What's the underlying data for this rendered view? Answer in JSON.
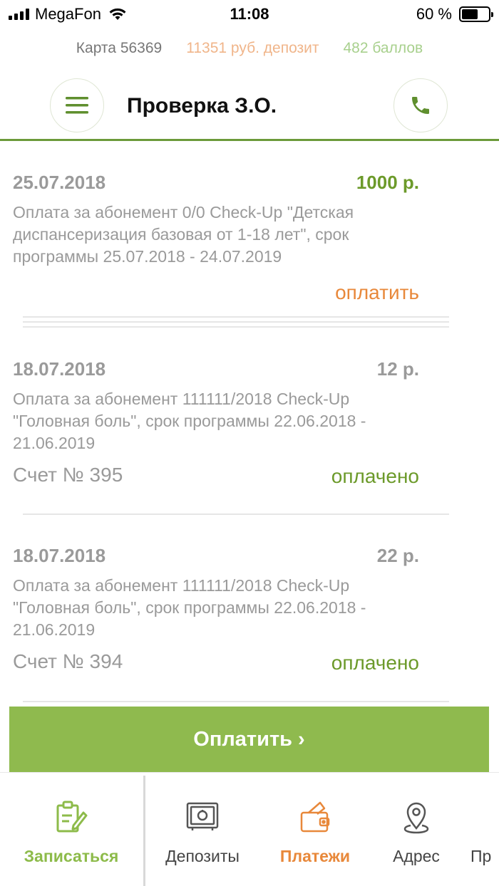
{
  "status_bar": {
    "carrier": "MegaFon",
    "time": "11:08",
    "battery": "60 %",
    "battery_level": 0.6
  },
  "info": {
    "card": "Карта 56369",
    "deposit": "11351 руб. депозит",
    "points": "482 баллов"
  },
  "header": {
    "title": "Проверка З.О.",
    "menu_icon": "menu-icon",
    "phone_icon": "phone-icon"
  },
  "payments": [
    {
      "date": "25.07.2018",
      "amount": "1000 р.",
      "description": "Оплата за абонемент 0/0 Check-Up \"Детская диспансеризация базовая от 1-18 лет\", срок программы 25.07.2018 - 24.07.2019",
      "action": "оплатить"
    },
    {
      "date": "18.07.2018",
      "amount": "12 р.",
      "description": "Оплата за абонемент 111111/2018 Check-Up \"Головная боль\", срок программы 22.06.2018 - 21.06.2019",
      "invoice": "Счет № 395",
      "status": "оплачено"
    },
    {
      "date": "18.07.2018",
      "amount": "22 р.",
      "description": "Оплата за абонемент 111111/2018 Check-Up \"Головная боль\", срок программы 22.06.2018 - 21.06.2019",
      "invoice": "Счет № 394",
      "status": "оплачено"
    }
  ],
  "pay_button": {
    "label": "Оплатить ›"
  },
  "bottom_nav": [
    {
      "label": "Записаться",
      "icon": "clipboard-pen-icon"
    },
    {
      "label": "Депозиты",
      "icon": "safe-icon"
    },
    {
      "label": "Платежи",
      "icon": "wallet-card-icon"
    },
    {
      "label": "Адрес",
      "icon": "map-pin-icon"
    },
    {
      "label": "Пр",
      "icon": ""
    }
  ],
  "colors": {
    "brand_green": "#6c9a2a",
    "button_green": "#8fba4e",
    "accent_orange": "#e8883a",
    "deposit_peach": "#f0b58a",
    "points_green": "#a8d08d"
  }
}
